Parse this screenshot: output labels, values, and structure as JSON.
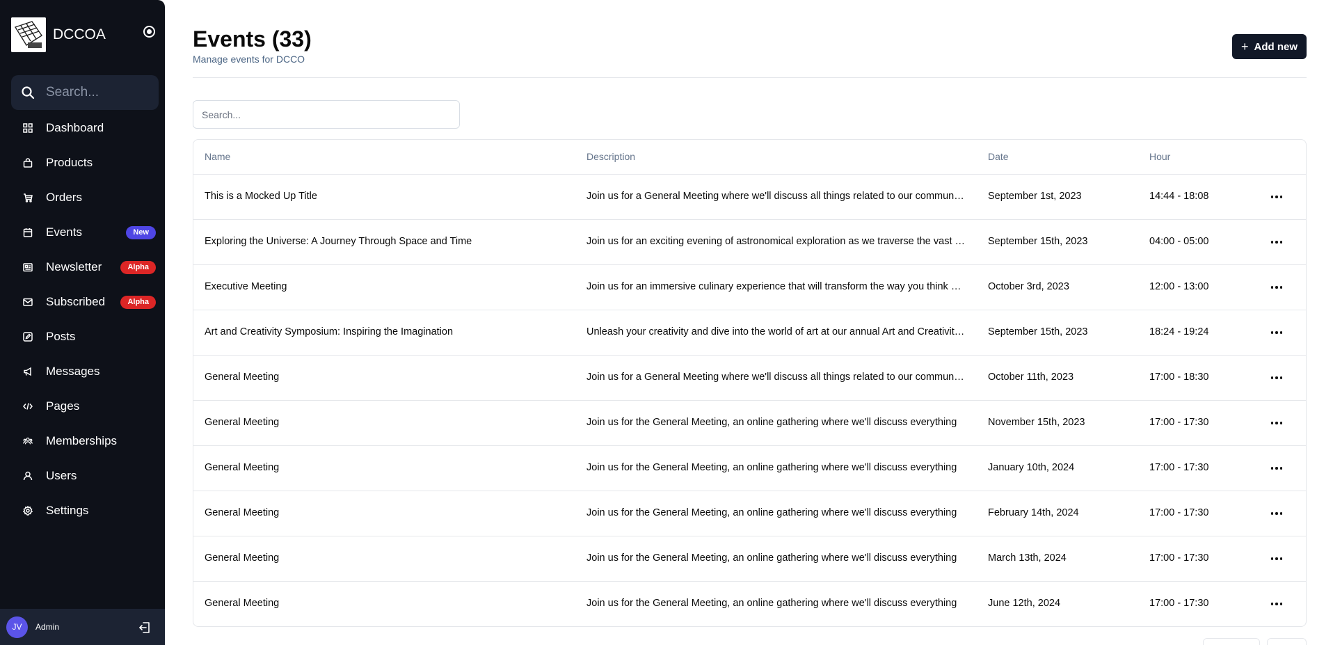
{
  "sidebar": {
    "brand": "DCCOA",
    "search_placeholder": "Search...",
    "items": [
      {
        "label": "Dashboard",
        "icon": "grid-icon",
        "badge": ""
      },
      {
        "label": "Products",
        "icon": "shopping-bag-icon",
        "badge": ""
      },
      {
        "label": "Orders",
        "icon": "cart-icon",
        "badge": ""
      },
      {
        "label": "Events",
        "icon": "calendar-icon",
        "badge": "New"
      },
      {
        "label": "Newsletter",
        "icon": "newspaper-icon",
        "badge": "Alpha"
      },
      {
        "label": "Subscribed",
        "icon": "mail-icon",
        "badge": "Alpha"
      },
      {
        "label": "Posts",
        "icon": "pencil-square-icon",
        "badge": ""
      },
      {
        "label": "Messages",
        "icon": "megaphone-icon",
        "badge": ""
      },
      {
        "label": "Pages",
        "icon": "code-icon",
        "badge": ""
      },
      {
        "label": "Memberships",
        "icon": "users-group-icon",
        "badge": ""
      },
      {
        "label": "Users",
        "icon": "user-icon",
        "badge": ""
      },
      {
        "label": "Settings",
        "icon": "gear-icon",
        "badge": ""
      }
    ],
    "user": {
      "initials": "JV",
      "name": "Admin"
    }
  },
  "header": {
    "title": "Events (33)",
    "subtitle": "Manage events for DCCO",
    "add_label": "Add new"
  },
  "search": {
    "placeholder": "Search..."
  },
  "table": {
    "columns": [
      "Name",
      "Description",
      "Date",
      "Hour"
    ],
    "rows": [
      {
        "name": "This is a Mocked Up Title",
        "description": "Join us for a General Meeting where we'll discuss all things related to our community and more",
        "date": "September 1st, 2023",
        "hour": "14:44 - 18:08"
      },
      {
        "name": "Exploring the Universe: A Journey Through Space and Time",
        "description": "Join us for an exciting evening of astronomical exploration as we traverse the vast cosmos",
        "date": "September 15th, 2023",
        "hour": "04:00 - 05:00"
      },
      {
        "name": "Executive Meeting",
        "description": "Join us for an immersive culinary experience that will transform the way you think about food",
        "date": "October 3rd, 2023",
        "hour": "12:00 - 13:00"
      },
      {
        "name": "Art and Creativity Symposium: Inspiring the Imagination",
        "description": "Unleash your creativity and dive into the world of art at our annual Art and Creativity Symposium",
        "date": "September 15th, 2023",
        "hour": "18:24 - 19:24"
      },
      {
        "name": "General Meeting",
        "description": "Join us for a General Meeting where we'll discuss all things related to our community and more",
        "date": "October 11th, 2023",
        "hour": "17:00 - 18:30"
      },
      {
        "name": "General Meeting",
        "description": "Join us for the General Meeting, an online gathering where we'll discuss everything",
        "date": "November 15th, 2023",
        "hour": "17:00 - 17:30"
      },
      {
        "name": "General Meeting",
        "description": "Join us for the General Meeting, an online gathering where we'll discuss everything",
        "date": "January 10th, 2024",
        "hour": "17:00 - 17:30"
      },
      {
        "name": "General Meeting",
        "description": "Join us for the General Meeting, an online gathering where we'll discuss everything",
        "date": "February 14th, 2024",
        "hour": "17:00 - 17:30"
      },
      {
        "name": "General Meeting",
        "description": "Join us for the General Meeting, an online gathering where we'll discuss everything",
        "date": "March 13th, 2024",
        "hour": "17:00 - 17:30"
      },
      {
        "name": "General Meeting",
        "description": "Join us for the General Meeting, an online gathering where we'll discuss everything",
        "date": "June 12th, 2024",
        "hour": "17:00 - 17:30"
      }
    ]
  },
  "colors": {
    "sidebar_bg": "#0e1119",
    "badge_new": "#4f46e5",
    "badge_alpha": "#dc2626",
    "primary_button": "#111827"
  }
}
